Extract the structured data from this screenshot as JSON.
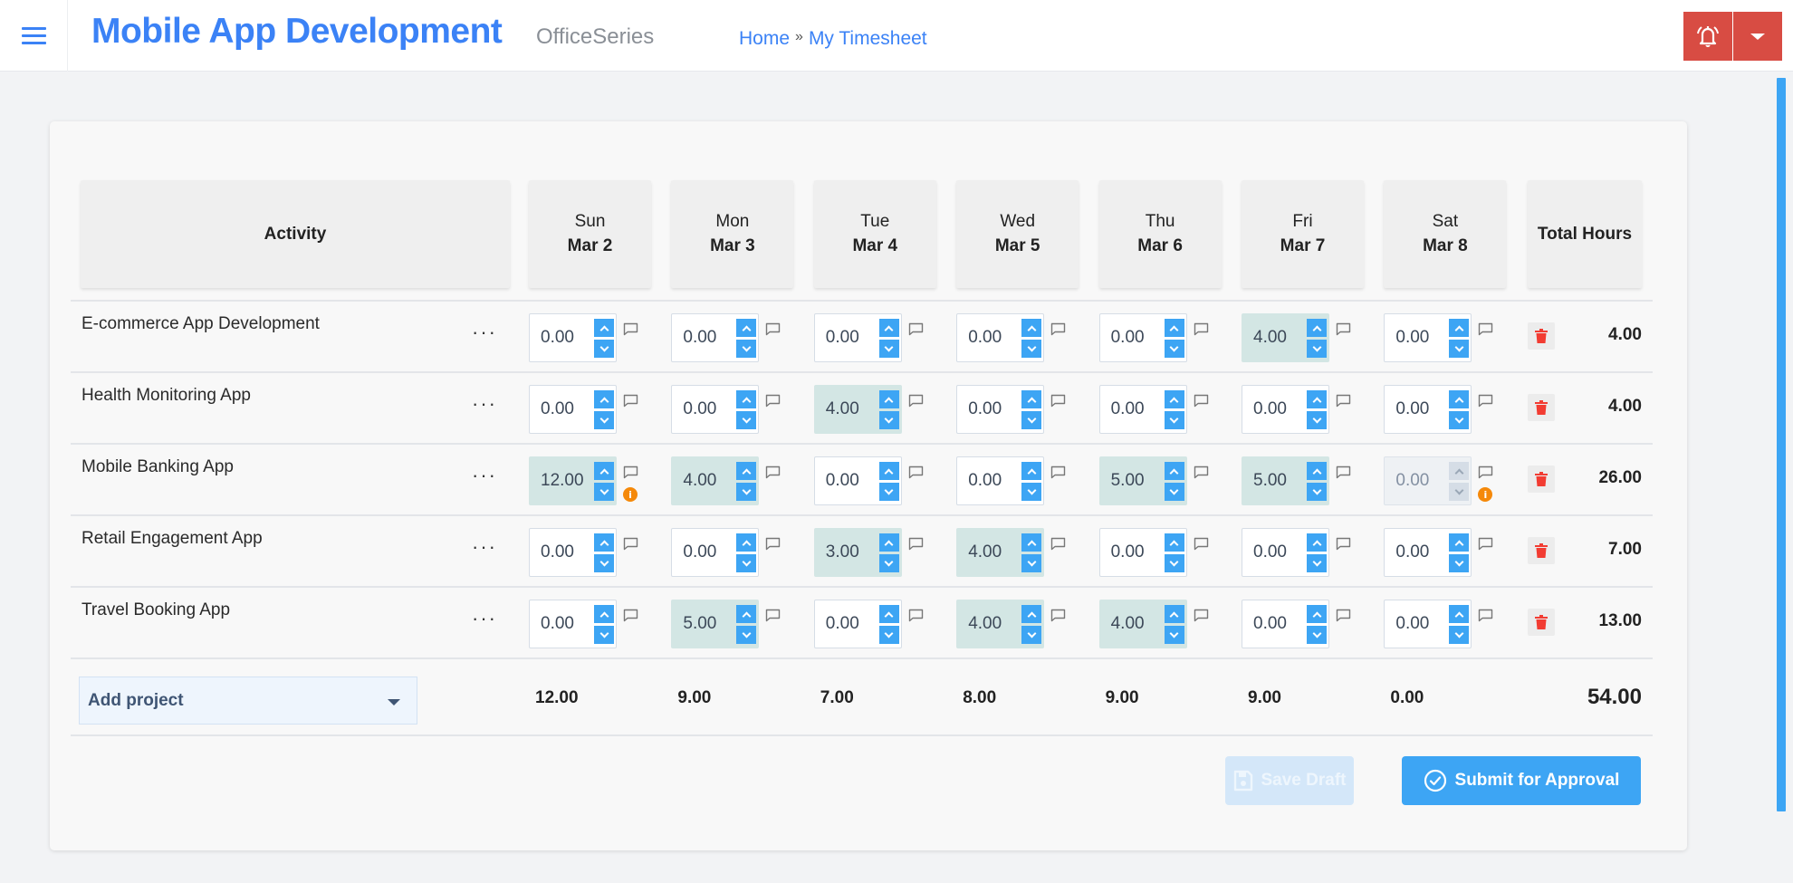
{
  "header": {
    "title": "Mobile App Development",
    "subtitle": "OfficeSeries",
    "breadcrumb": [
      {
        "label": "Home"
      },
      {
        "label": "My Timesheet"
      }
    ],
    "breadcrumb_separator": "»",
    "icons": {
      "menu": "hamburger-icon",
      "bell": "bell-icon",
      "dropdown": "caret-down-icon"
    }
  },
  "timesheet": {
    "activity_header": "Activity",
    "total_header": "Total Hours",
    "days": [
      {
        "day": "Sun",
        "date": "Mar 2"
      },
      {
        "day": "Mon",
        "date": "Mar 3"
      },
      {
        "day": "Tue",
        "date": "Mar 4"
      },
      {
        "day": "Wed",
        "date": "Mar 5"
      },
      {
        "day": "Thu",
        "date": "Mar 6"
      },
      {
        "day": "Fri",
        "date": "Mar 7"
      },
      {
        "day": "Sat",
        "date": "Mar 8"
      }
    ],
    "more_label": "···",
    "rows": [
      {
        "name": "E-commerce App Development",
        "hours": [
          "0.00",
          "0.00",
          "0.00",
          "0.00",
          "0.00",
          "4.00",
          "0.00"
        ],
        "total": "4.00",
        "warnings": [],
        "disabled": []
      },
      {
        "name": "Health Monitoring App",
        "hours": [
          "0.00",
          "0.00",
          "4.00",
          "0.00",
          "0.00",
          "0.00",
          "0.00"
        ],
        "total": "4.00",
        "warnings": [],
        "disabled": []
      },
      {
        "name": "Mobile Banking App",
        "hours": [
          "12.00",
          "4.00",
          "0.00",
          "0.00",
          "5.00",
          "5.00",
          "0.00"
        ],
        "total": "26.00",
        "warnings": [
          0,
          6
        ],
        "disabled": [
          6
        ]
      },
      {
        "name": "Retail Engagement App",
        "hours": [
          "0.00",
          "0.00",
          "3.00",
          "4.00",
          "0.00",
          "0.00",
          "0.00"
        ],
        "total": "7.00",
        "warnings": [],
        "disabled": []
      },
      {
        "name": "Travel Booking App",
        "hours": [
          "0.00",
          "5.00",
          "0.00",
          "4.00",
          "4.00",
          "0.00",
          "0.00"
        ],
        "total": "13.00",
        "warnings": [],
        "disabled": []
      }
    ],
    "warning_glyph": "i",
    "add_project_label": "Add project",
    "day_totals": [
      "12.00",
      "9.00",
      "7.00",
      "8.00",
      "9.00",
      "9.00",
      "0.00"
    ],
    "grand_total": "54.00"
  },
  "actions": {
    "save_draft": "Save Draft",
    "submit": "Submit for Approval"
  },
  "colors": {
    "brand": "#3b82f6",
    "accent": "#3da5f4",
    "header_button": "#d84c43",
    "filled_cell": "#d3e6e4",
    "warning": "#f5890a",
    "delete": "#f23c32"
  }
}
